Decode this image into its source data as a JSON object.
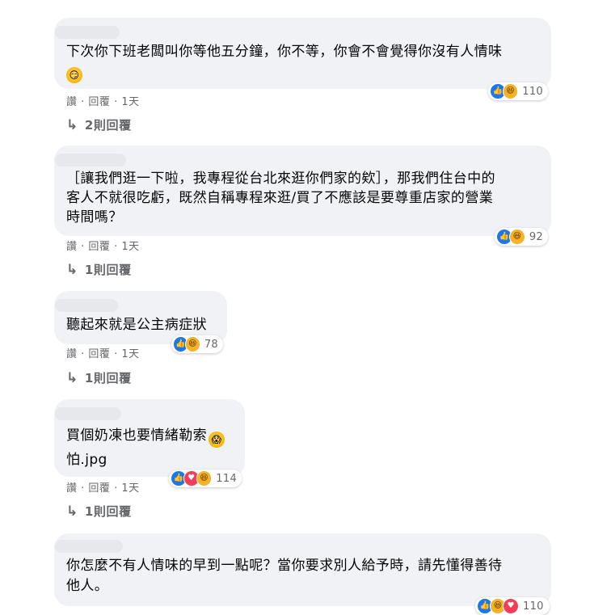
{
  "comments": [
    {
      "lines": [
        "下次你下班老闆叫你等他五分鐘，你不等，你會不會覺得你沒有人情味"
      ],
      "emoji": "smirk-emoji",
      "reaction_icons": [
        "like",
        "haha"
      ],
      "reaction_count": "110",
      "actions": {
        "like": "讚",
        "reply": "回覆",
        "time": "1天"
      },
      "replies_label": "2則回覆"
    },
    {
      "lines": [
        "［讓我們逛一下啦，我專程從台北來逛你們家的欸］，那我們住台中的",
        "客人不就很吃虧，既然自稱專程來逛/買了不應該是要尊重店家的營業",
        "時間嗎？"
      ],
      "reaction_icons": [
        "like",
        "haha"
      ],
      "reaction_count": "92",
      "actions": {
        "like": "讚",
        "reply": "回覆",
        "time": "1天"
      },
      "replies_label": "1則回覆"
    },
    {
      "lines": [
        "聽起來就是公主病症狀"
      ],
      "reaction_icons": [
        "like",
        "haha"
      ],
      "reaction_count": "78",
      "actions": {
        "like": "讚",
        "reply": "回覆",
        "time": "1天"
      },
      "replies_label": "1則回覆"
    },
    {
      "lines": [
        "買個奶凍也要情緒勒索",
        "怕.jpg"
      ],
      "emoji": "screaming-emoji",
      "reaction_icons": [
        "like",
        "love",
        "haha"
      ],
      "reaction_count": "114",
      "actions": {
        "like": "讚",
        "reply": "回覆",
        "time": "1天"
      },
      "replies_label": "1則回覆"
    },
    {
      "lines": [
        "你怎麼不有人情味的早到一點呢？當你要求別人給予時，請先懂得善待",
        "他人。"
      ],
      "reaction_icons": [
        "like",
        "haha",
        "love"
      ],
      "reaction_count": "110"
    }
  ],
  "colors": {
    "bubble": "#f0f2f5",
    "secondary_text": "#65676b",
    "like": "#1877f2",
    "love": "#f33e58",
    "haha": "#f7b125"
  }
}
